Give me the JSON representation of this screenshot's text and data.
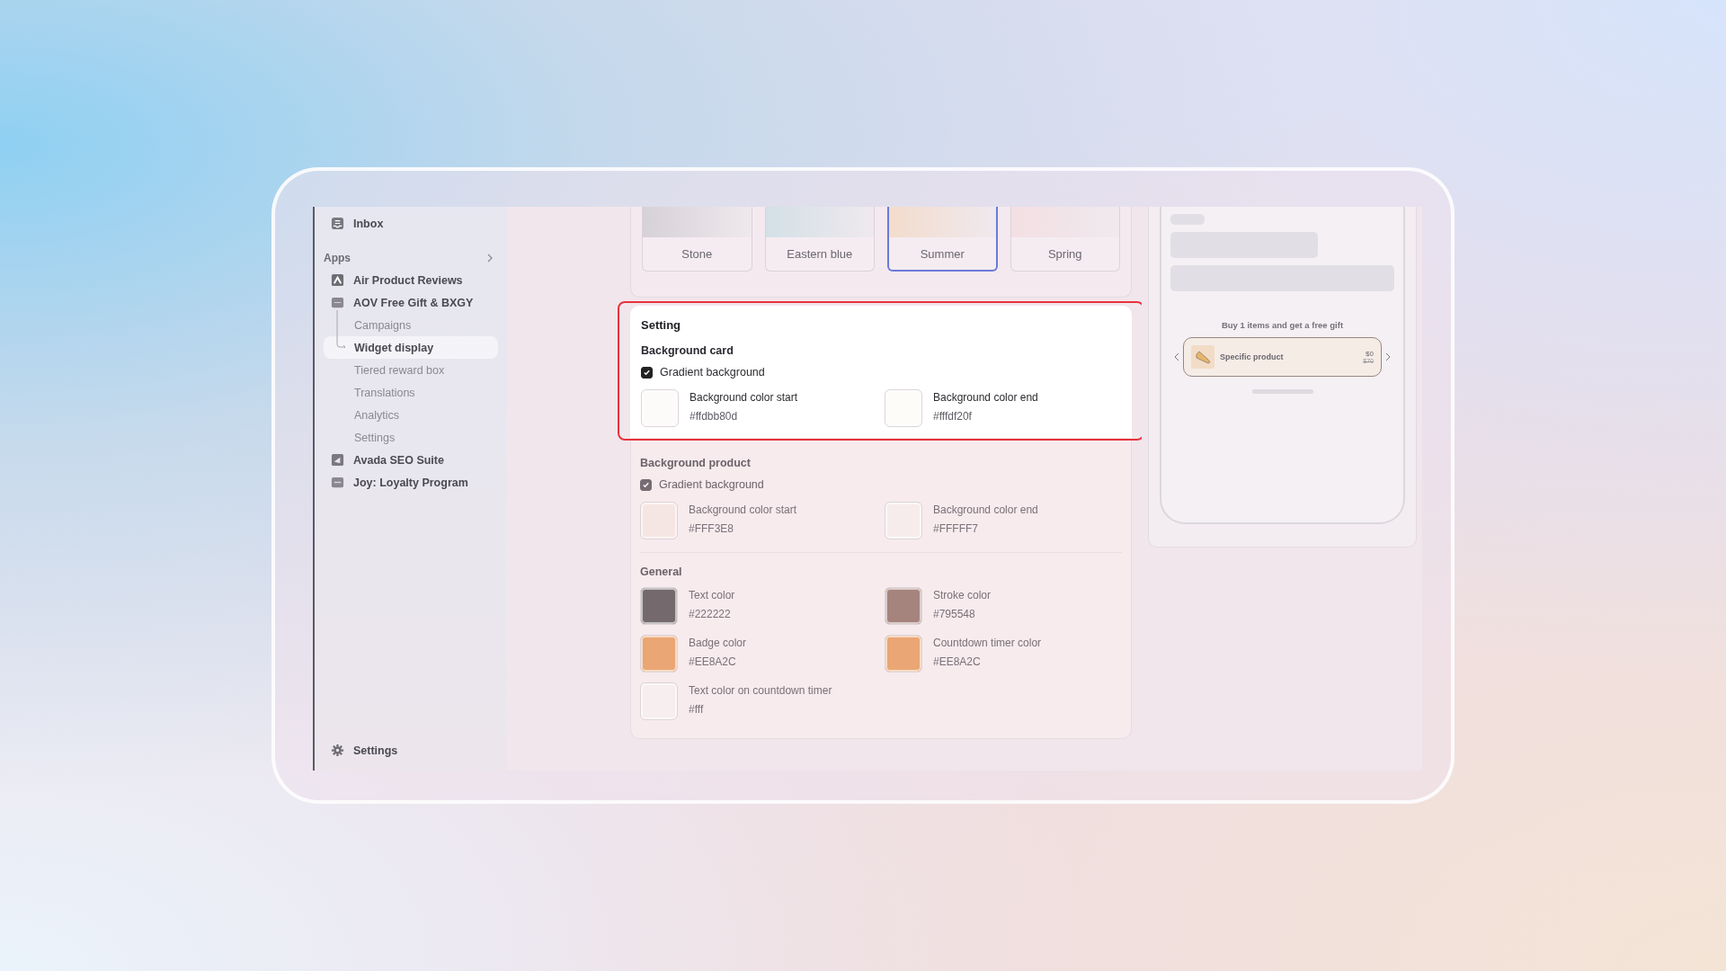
{
  "sidebar": {
    "top": [
      {
        "label": "Inbox",
        "kind": "inbox"
      }
    ],
    "section": "Apps",
    "apps": [
      {
        "label": "Air Product Reviews",
        "kind": "reviews"
      },
      {
        "label": "AOV Free Gift & BXGY",
        "kind": "gift",
        "children": [
          {
            "label": "Campaigns",
            "selected": false
          },
          {
            "label": "Widget display",
            "selected": true
          },
          {
            "label": "Tiered reward box",
            "selected": false
          },
          {
            "label": "Translations",
            "selected": false
          },
          {
            "label": "Analytics",
            "selected": false
          },
          {
            "label": "Settings",
            "selected": false
          }
        ]
      },
      {
        "label": "Avada SEO Suite",
        "kind": "seo"
      },
      {
        "label": "Joy: Loyalty Program",
        "kind": "loyalty"
      }
    ],
    "footer": {
      "label": "Settings",
      "kind": "gear"
    }
  },
  "presets": [
    {
      "label": "Stone",
      "selected": false,
      "color": "#d6d1d6"
    },
    {
      "label": "Eastern blue",
      "selected": false,
      "color": "#d3e0e6"
    },
    {
      "label": "Summer",
      "selected": true,
      "color": "#f3dccc"
    },
    {
      "label": "Spring",
      "selected": false,
      "color": "#f3dfe3"
    }
  ],
  "settings_card": {
    "title": "Setting",
    "highlighted": true,
    "groups": [
      {
        "title": "Background card",
        "gradient": {
          "label": "Gradient background",
          "checked": true
        },
        "colors": [
          {
            "label": "Background color start",
            "value": "#ffdbb80d",
            "color": "#fdfbf9"
          },
          {
            "label": "Background color end",
            "value": "#fffdf20f",
            "color": "#fdfcf9"
          }
        ]
      }
    ]
  },
  "lower_card": {
    "groups": [
      {
        "title": "Background product",
        "gradient": {
          "label": "Gradient background",
          "checked": true
        },
        "colors": [
          {
            "label": "Background color start",
            "value": "#FFF3E8",
            "color": "#f6e6e3"
          },
          {
            "label": "Background color end",
            "value": "#FFFFF7",
            "color": "#f7ecec"
          }
        ]
      },
      {
        "title": "General",
        "colors": [
          {
            "label": "Text color",
            "value": "#222222",
            "color": "#746a6d"
          },
          {
            "label": "Stroke color",
            "value": "#795548",
            "color": "#a6847e"
          },
          {
            "label": "Badge color",
            "value": "#EE8A2C",
            "color": "#eaa674"
          },
          {
            "label": "Countdown timer color",
            "value": "#EE8A2C",
            "color": "#eaa674"
          },
          {
            "label": "Text color on countdown timer",
            "value": "#fff",
            "color": "#f7eef0"
          }
        ]
      }
    ]
  },
  "preview": {
    "headline": "Buy 1 items and get a free gift",
    "product": {
      "name": "Specific product",
      "price": "$0",
      "compare_price": "$70"
    }
  }
}
